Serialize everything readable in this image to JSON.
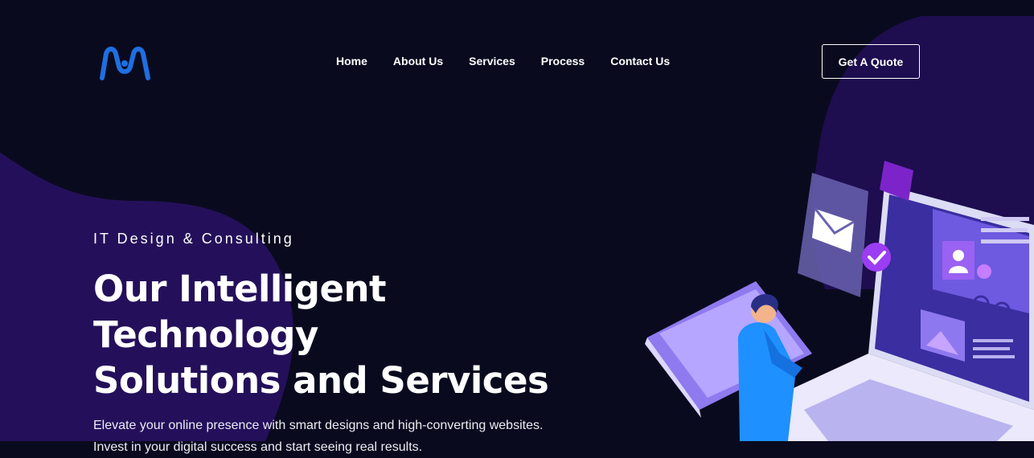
{
  "brand": {
    "logo_icon": "m-wave-logo",
    "accent": "#1e6fe0"
  },
  "nav": {
    "items": [
      {
        "label": "Home"
      },
      {
        "label": "About Us"
      },
      {
        "label": "Services"
      },
      {
        "label": "Process"
      },
      {
        "label": "Contact Us"
      }
    ],
    "cta_label": "Get A Quote"
  },
  "hero": {
    "eyebrow": "IT Design & Consulting",
    "headline_line1": "Our Intelligent Technology",
    "headline_line2": "Solutions and Services",
    "sub_line1": "Elevate your online presence with smart designs and high-converting websites.",
    "sub_line2": "Invest in your digital success and start seeing real results."
  },
  "colors": {
    "background": "#0a0a1f",
    "blob": "#2a1164",
    "illustration_primary": "#7a5bf0"
  }
}
